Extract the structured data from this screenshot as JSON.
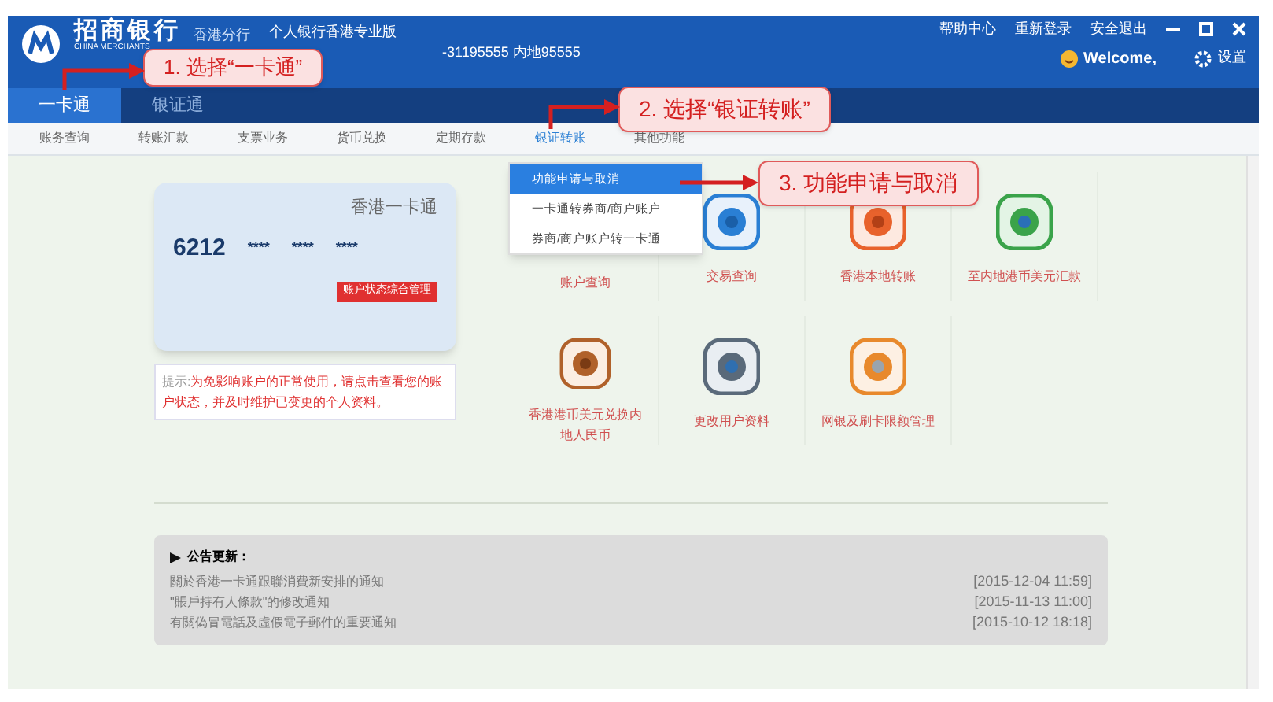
{
  "header": {
    "logo_text": "招商银行",
    "logo_subtext": "CHINA MERCHANTS",
    "branch": "香港分行",
    "edition": "个人银行香港专业版",
    "hotline": "-31195555 内地95555",
    "links": [
      "帮助中心",
      "重新登录",
      "安全退出"
    ],
    "welcome": "Welcome,",
    "settings": "设置"
  },
  "tabs": [
    {
      "label": "一卡通",
      "selected": true
    },
    {
      "label": "银证通",
      "selected": false
    }
  ],
  "subnav": [
    {
      "label": "账务查询",
      "selected": false
    },
    {
      "label": "转账汇款",
      "selected": false
    },
    {
      "label": "支票业务",
      "selected": false
    },
    {
      "label": "货币兑换",
      "selected": false
    },
    {
      "label": "定期存款",
      "selected": false
    },
    {
      "label": "银证转账",
      "selected": true
    },
    {
      "label": "其他功能",
      "selected": false
    }
  ],
  "dropdown": [
    {
      "label": "功能申请与取消",
      "selected": true
    },
    {
      "label": "一卡通转券商/商户账户",
      "selected": false
    },
    {
      "label": "券商/商户账户转一卡通",
      "selected": false
    }
  ],
  "card": {
    "title": "香港一卡通",
    "number": "6212",
    "masks": [
      "****",
      "****",
      "****"
    ],
    "button": "账户状态综合管理"
  },
  "notice": {
    "label": "提示:",
    "text": "为免影响账户的正常使用，请点击查看您的账户状态，并及时维护已变更的个人资料。"
  },
  "services": [
    {
      "label": "账户查询"
    },
    {
      "label": "交易查询"
    },
    {
      "label": "香港本地转账"
    },
    {
      "label": "至内地港币美元汇款"
    },
    {
      "label": "香港港币美元兑换内地人民币"
    },
    {
      "label": "更改用户资料"
    },
    {
      "label": "网银及刷卡限额管理"
    }
  ],
  "announcements": {
    "title": "公告更新：",
    "items": [
      {
        "title": "關於香港一卡通跟聯消費新安排的通知",
        "date": "[2015-12-04 11:59]"
      },
      {
        "title": "\"賬戶持有人條款\"的修改通知",
        "date": "[2015-11-13 11:00]"
      },
      {
        "title": "有關偽冒電話及虛假電子郵件的重要通知",
        "date": "[2015-10-12 18:18]"
      }
    ]
  },
  "callouts": [
    "1. 选择“一卡通”",
    "2. 选择“银证转账”",
    "3. 功能申请与取消"
  ]
}
